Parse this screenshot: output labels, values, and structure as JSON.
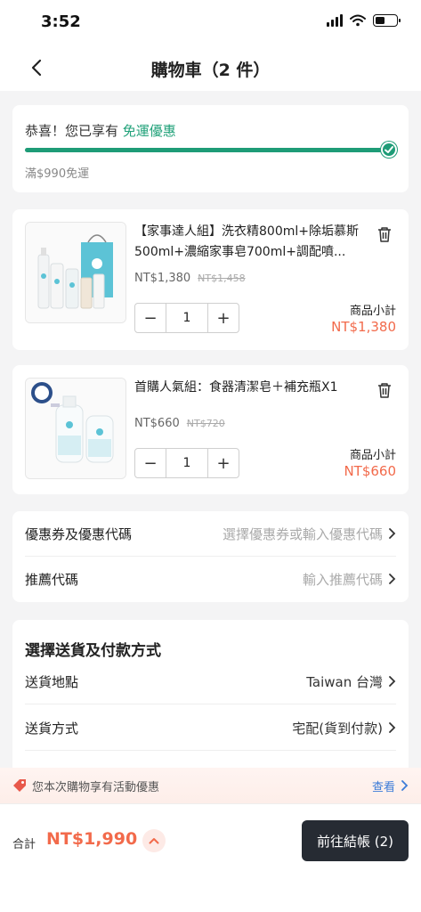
{
  "status_bar": {
    "time": "3:52"
  },
  "header": {
    "title": "購物車（2 件）"
  },
  "promo": {
    "message": "恭喜！您已享有 ",
    "highlight": "免運優惠",
    "progress": 1.0,
    "threshold_note": "滿$990免運",
    "accent_color": "#1e9c77"
  },
  "products": [
    {
      "name": "【家事達人組】洗衣精800ml+除垢慕斯500ml+濃縮家事皂700ml+調配噴...",
      "price": "NT$1,380",
      "original_price": "NT$1,458",
      "quantity": "1",
      "subtotal_label": "商品小計",
      "subtotal": "NT$1,380"
    },
    {
      "name": "首購人氣組：食器清潔皂＋補充瓶X1",
      "price": "NT$660",
      "original_price": "NT$720",
      "quantity": "1",
      "subtotal_label": "商品小計",
      "subtotal": "NT$660"
    }
  ],
  "coupon": {
    "coupon_label": "優惠券及優惠代碼",
    "coupon_placeholder": "選擇優惠券或輸入優惠代碼",
    "referral_label": "推薦代碼",
    "referral_placeholder": "輸入推薦代碼"
  },
  "shipping": {
    "heading": "選擇送貨及付款方式",
    "location_label": "送貨地點",
    "location_value": "Taiwan 台灣",
    "method_label": "送貨方式",
    "method_value": "宅配(貨到付款)"
  },
  "activity": {
    "text": "您本次購物享有活動優惠",
    "link": "查看"
  },
  "footer": {
    "total_label": "合計",
    "total": "NT$1,990",
    "checkout_label": "前往結帳 (2)",
    "price_color": "#f26a4b"
  }
}
